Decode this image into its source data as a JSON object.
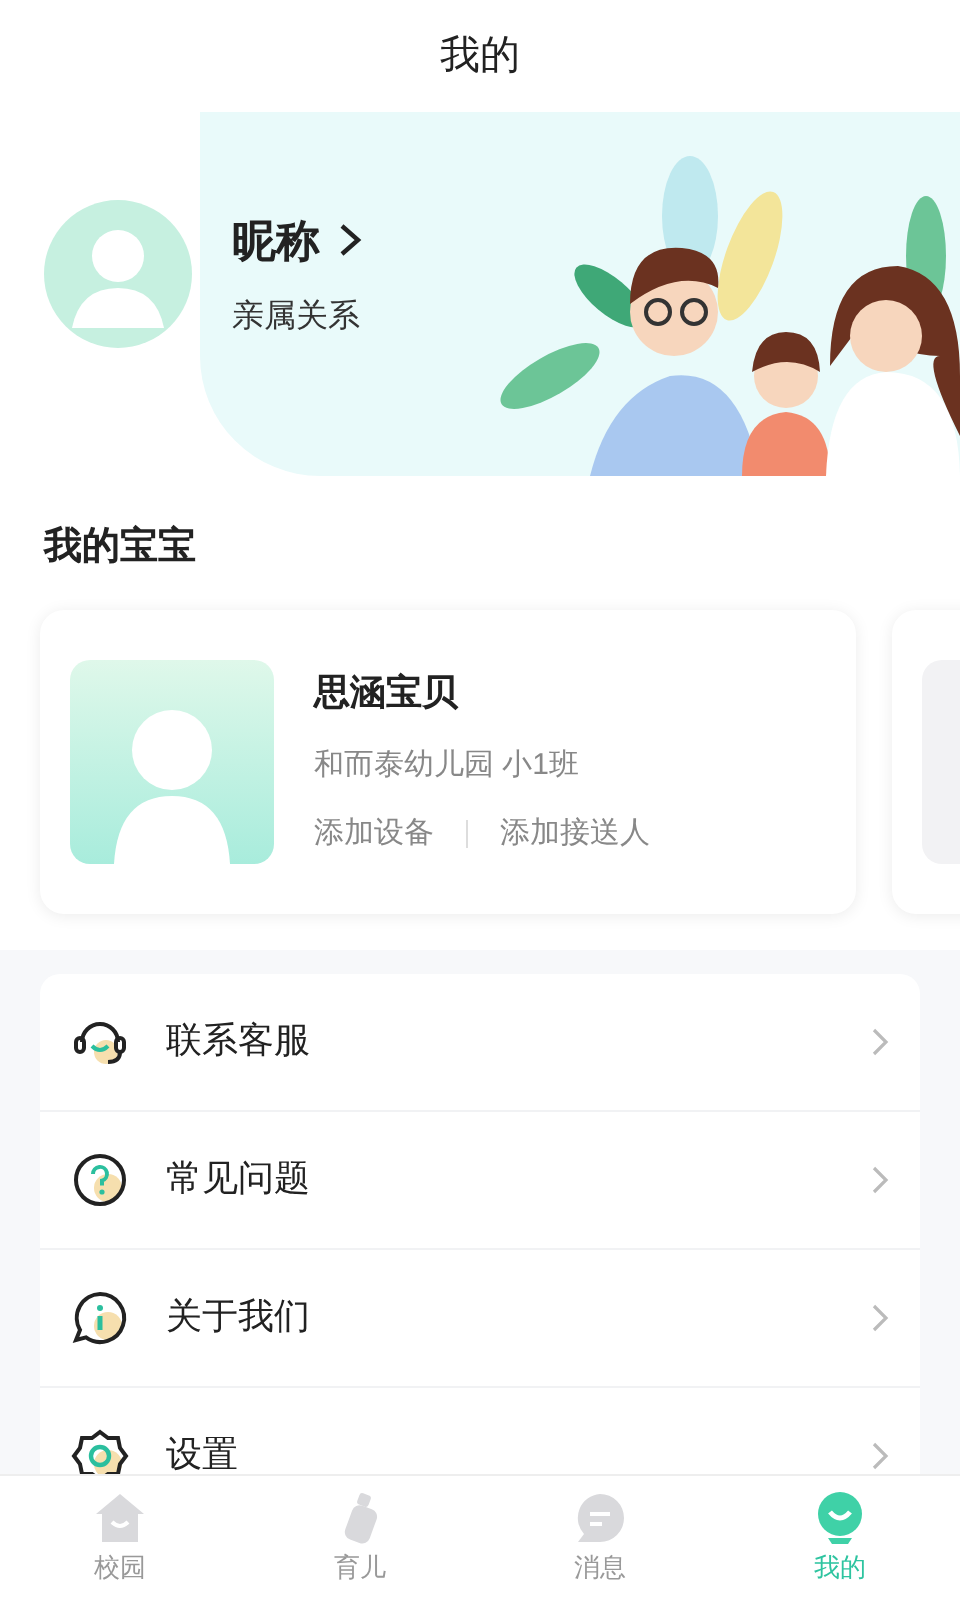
{
  "header": {
    "title": "我的"
  },
  "profile": {
    "nickname": "昵称",
    "relation": "亲属关系"
  },
  "section_title": "我的宝宝",
  "babies": [
    {
      "name": "思涵宝贝",
      "school": "和而泰幼儿园 小1班",
      "actions": [
        "添加设备",
        "添加接送人"
      ]
    }
  ],
  "menu": [
    {
      "kind": "headset",
      "label": "联系客服"
    },
    {
      "kind": "question",
      "label": "常见问题"
    },
    {
      "kind": "info",
      "label": "关于我们"
    },
    {
      "kind": "settings",
      "label": "设置"
    }
  ],
  "tabs": [
    {
      "kind": "campus",
      "label": "校园",
      "selected": false
    },
    {
      "kind": "parenting",
      "label": "育儿",
      "selected": false
    },
    {
      "kind": "messages",
      "label": "消息",
      "selected": false
    },
    {
      "kind": "me",
      "label": "我的",
      "selected": true
    }
  ]
}
